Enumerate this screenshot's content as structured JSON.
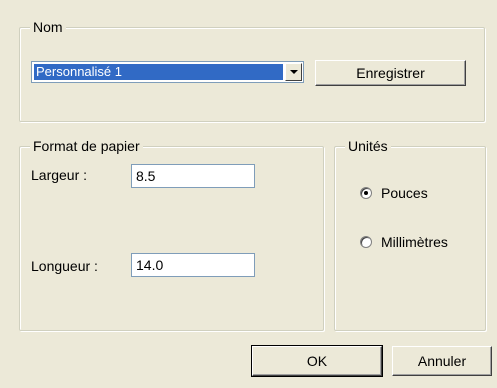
{
  "nom_group": {
    "legend": "Nom",
    "combo_value": "Personnalisé 1",
    "save_label": "Enregistrer"
  },
  "paper_group": {
    "legend": "Format de papier",
    "width_label": "Largeur :",
    "width_value": "8.5",
    "length_label": "Longueur :",
    "length_value": "14.0"
  },
  "units_group": {
    "legend": "Unités",
    "options": [
      {
        "label": "Pouces",
        "checked": true
      },
      {
        "label": "Millimètres",
        "checked": false
      }
    ]
  },
  "footer": {
    "ok_label": "OK",
    "cancel_label": "Annuler"
  },
  "icons": {
    "combo_arrow": "chevron-down-icon",
    "radio": "radio-button-icon"
  }
}
